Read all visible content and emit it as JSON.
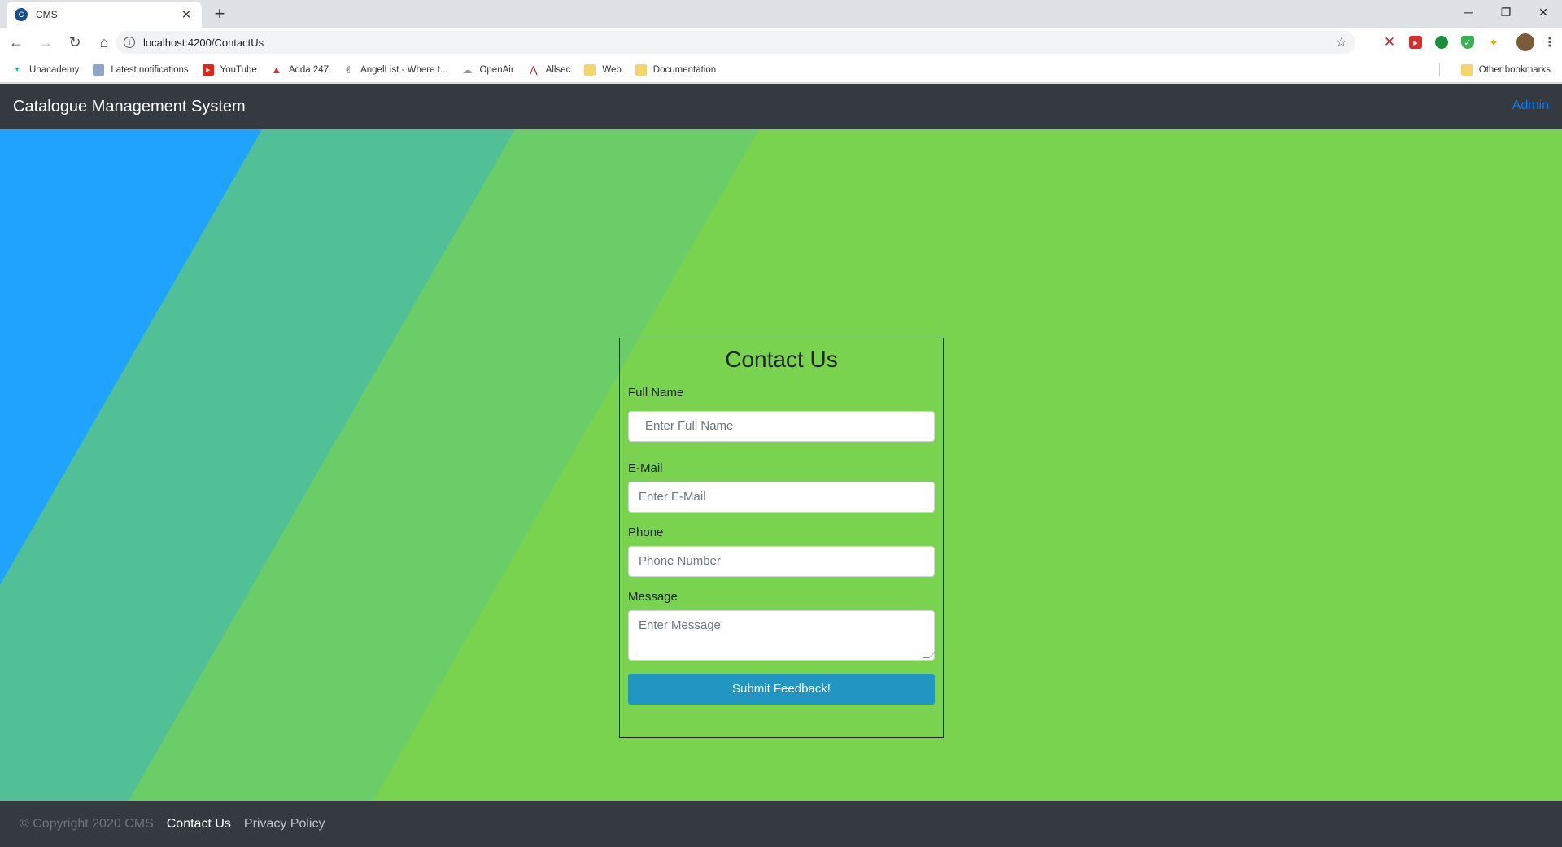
{
  "browser": {
    "tab_title": "CMS",
    "tab_favicon_text": "C",
    "tab_close": "✕",
    "new_tab": "+",
    "window_controls": {
      "minimize": "─",
      "restore": "❐",
      "close": "✕"
    },
    "nav": {
      "back": "←",
      "forward": "→",
      "reload": "↻",
      "home": "⌂"
    },
    "url": "localhost:4200/ContactUs",
    "info_icon_text": "i",
    "star": "☆",
    "bookmarks": [
      {
        "label": "Unacademy",
        "icon": "unacademy-icon"
      },
      {
        "label": "Latest notifications",
        "icon": "notifications-icon"
      },
      {
        "label": "YouTube",
        "icon": "youtube-icon"
      },
      {
        "label": "Adda 247",
        "icon": "adda-icon"
      },
      {
        "label": "AngelList - Where t...",
        "icon": "angellist-icon"
      },
      {
        "label": "OpenAir",
        "icon": "openair-icon"
      },
      {
        "label": "Allsec",
        "icon": "allsec-icon"
      },
      {
        "label": "Web",
        "icon": "folder-icon"
      },
      {
        "label": "Documentation",
        "icon": "folder-icon"
      }
    ],
    "other_bookmarks": "Other bookmarks"
  },
  "navbar": {
    "brand": "Catalogue Management System",
    "admin": "Admin"
  },
  "form": {
    "title": "Contact Us",
    "fullname": {
      "label": "Full Name",
      "placeholder": "Enter Full Name"
    },
    "email": {
      "label": "E-Mail",
      "placeholder": "Enter E-Mail"
    },
    "phone": {
      "label": "Phone",
      "placeholder": "Phone Number"
    },
    "message": {
      "label": "Message",
      "placeholder": "Enter Message"
    },
    "submit": "Submit Feedback!"
  },
  "footer": {
    "copyright": "© Copyright 2020 CMS",
    "contact": "Contact Us",
    "privacy": "Privacy Policy"
  },
  "colors": {
    "hero_base": "#7ad34f",
    "stripe_blue": "#1fa3ff",
    "stripe_teal": "#51c096",
    "stripe_green": "#6bcd68",
    "navbar": "#343a40",
    "admin_link": "#007bff",
    "submit_button": "#2196c3"
  }
}
